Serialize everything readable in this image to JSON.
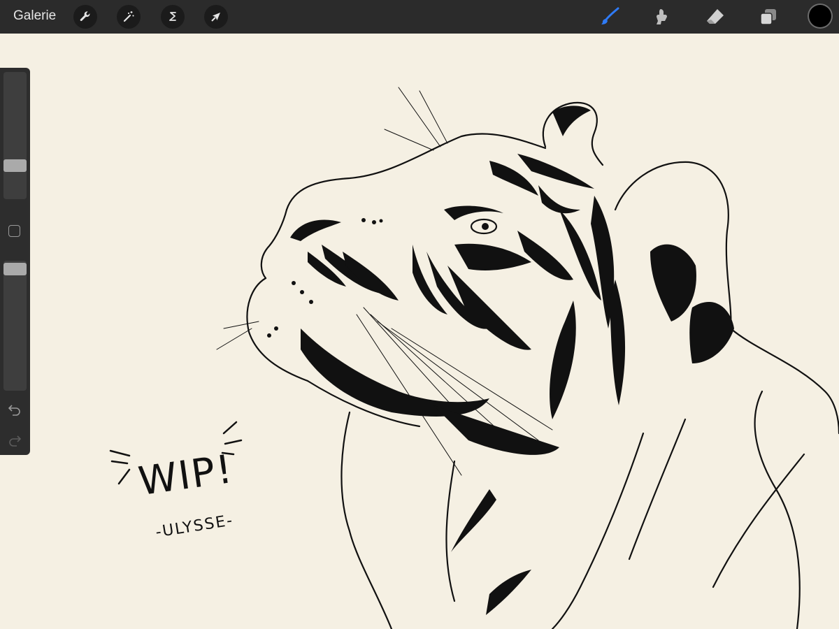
{
  "topbar": {
    "gallery_label": "Galerie",
    "left_tools": [
      "wrench-icon",
      "magic-wand-icon",
      "selection-icon",
      "transform-arrow-icon"
    ],
    "right_tools": [
      "brush-icon",
      "smudge-icon",
      "eraser-icon",
      "layers-icon"
    ],
    "active_tool": "brush",
    "active_color": "#000000",
    "accent_color": "#2f7bf6"
  },
  "sidebar": {
    "brush_size_level": 0.24,
    "opacity_level": 0.98,
    "undo_icon": "undo-icon",
    "redo_icon": "redo-icon"
  },
  "canvas": {
    "background_color": "#f5f0e3",
    "wip_text": "WIP!",
    "signature_text": "-ULYSSE-"
  }
}
